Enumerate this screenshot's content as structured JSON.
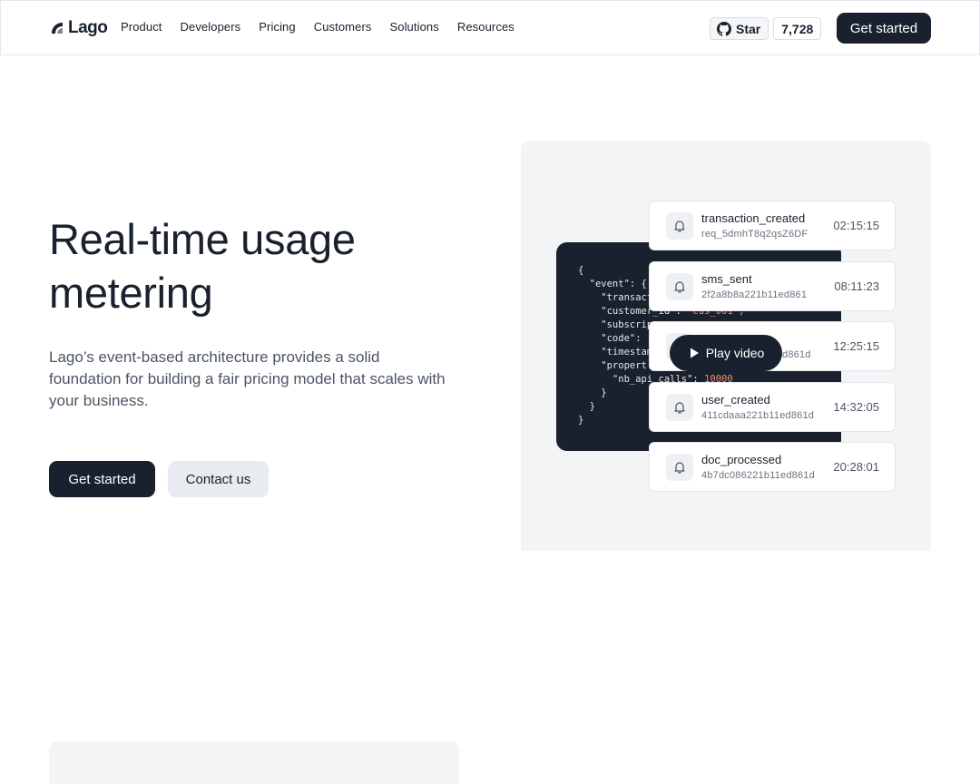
{
  "nav": {
    "logo_text": "Lago",
    "links": [
      "Product",
      "Developers",
      "Pricing",
      "Customers",
      "Solutions",
      "Resources"
    ],
    "star_label": "Star",
    "star_count": "7,728",
    "cta": "Get started"
  },
  "hero": {
    "title_line1": "Real-time usage",
    "title_line2": "metering",
    "description": "Lago’s event-based architecture provides a solid foundation for building a fair pricing model that scales with your business.",
    "primary_cta": "Get started",
    "secondary_cta": "Contact us"
  },
  "illustration": {
    "code_lines": [
      "{",
      "  \"event\": {",
      "    \"transact",
      "    \"customer_id\": ",
      "    \"subscrip",
      "    \"code\": ",
      "    \"timestam",
      "    \"propert",
      "      \"nb_api_calls\": ",
      "    }",
      "  }",
      "}"
    ],
    "code_values": {
      "customer_id": "\"cus_001\",",
      "nb_api_calls": "10000"
    },
    "play_label": "Play video",
    "events": [
      {
        "name": "transaction_created",
        "id": "req_5dmhT8q2qsZ6DF",
        "time": "02:15:15"
      },
      {
        "name": "sms_sent",
        "id": "2f2a8b8a221b11ed861",
        "time": "08:11:23"
      },
      {
        "name": "",
        "id": "d861d",
        "time": "12:25:15"
      },
      {
        "name": "user_created",
        "id": "411cdaaa221b11ed861d",
        "time": "14:32:05"
      },
      {
        "name": "doc_processed",
        "id": "4b7dc086221b11ed861d",
        "time": "20:28:01"
      }
    ]
  },
  "colors": {
    "dark": "#19212e",
    "panel": "#f3f4f6",
    "code_string": "#f28b6c"
  }
}
